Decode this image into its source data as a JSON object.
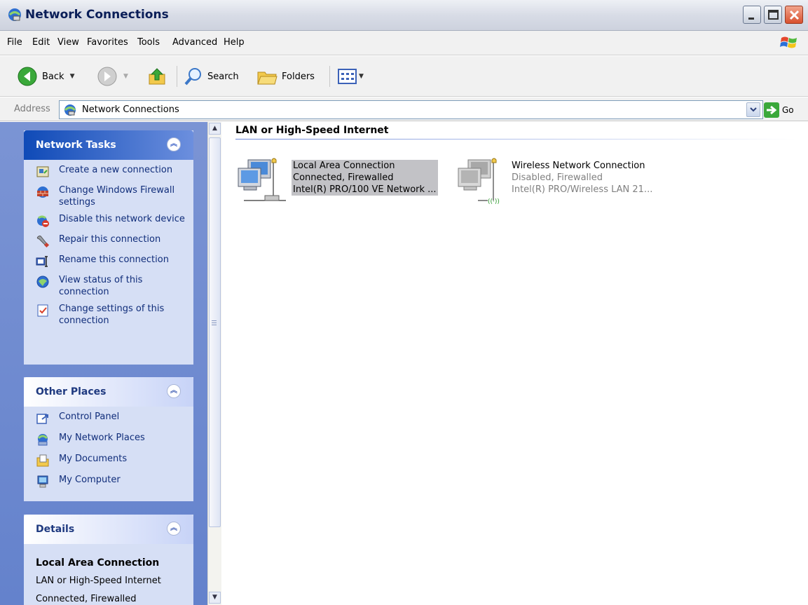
{
  "window": {
    "title": "Network Connections"
  },
  "menu": [
    "File",
    "Edit",
    "View",
    "Favorites",
    "Tools",
    "Advanced",
    "Help"
  ],
  "toolbar": {
    "back_label": "Back",
    "search_label": "Search",
    "folders_label": "Folders"
  },
  "address": {
    "label": "Address",
    "value": "Network Connections",
    "go_label": "Go"
  },
  "network_tasks": {
    "title": "Network Tasks",
    "items": [
      {
        "label": "Create a new connection",
        "icon": "new-connection-icon"
      },
      {
        "label": "Change Windows Firewall settings",
        "icon": "firewall-icon"
      },
      {
        "label": "Disable this network device",
        "icon": "disable-device-icon"
      },
      {
        "label": "Repair this connection",
        "icon": "repair-icon"
      },
      {
        "label": "Rename this connection",
        "icon": "rename-icon"
      },
      {
        "label": "View status of this connection",
        "icon": "status-icon"
      },
      {
        "label": "Change settings of this connection",
        "icon": "settings-icon"
      }
    ]
  },
  "other_places": {
    "title": "Other Places",
    "items": [
      {
        "label": "Control Panel",
        "icon": "control-panel-icon"
      },
      {
        "label": "My Network Places",
        "icon": "network-places-icon"
      },
      {
        "label": "My Documents",
        "icon": "documents-icon"
      },
      {
        "label": "My Computer",
        "icon": "computer-icon"
      }
    ]
  },
  "details": {
    "title": "Details",
    "name": "Local Area Connection",
    "type": "LAN or High-Speed Internet",
    "status": "Connected, Firewalled"
  },
  "group": {
    "title": "LAN or High-Speed Internet"
  },
  "connections": [
    {
      "name": "Local Area Connection",
      "status": "Connected, Firewalled",
      "device": "Intel(R) PRO/100 VE Network ...",
      "selected": true
    },
    {
      "name": "Wireless Network Connection",
      "status": "Disabled, Firewalled",
      "device": "Intel(R) PRO/Wireless LAN 21...",
      "selected": false
    }
  ],
  "colors": {
    "task_pane": "#7b94d4",
    "panel_body": "#d6dff5",
    "link_text": "#102d7a",
    "selection": "#c2c2c6"
  }
}
